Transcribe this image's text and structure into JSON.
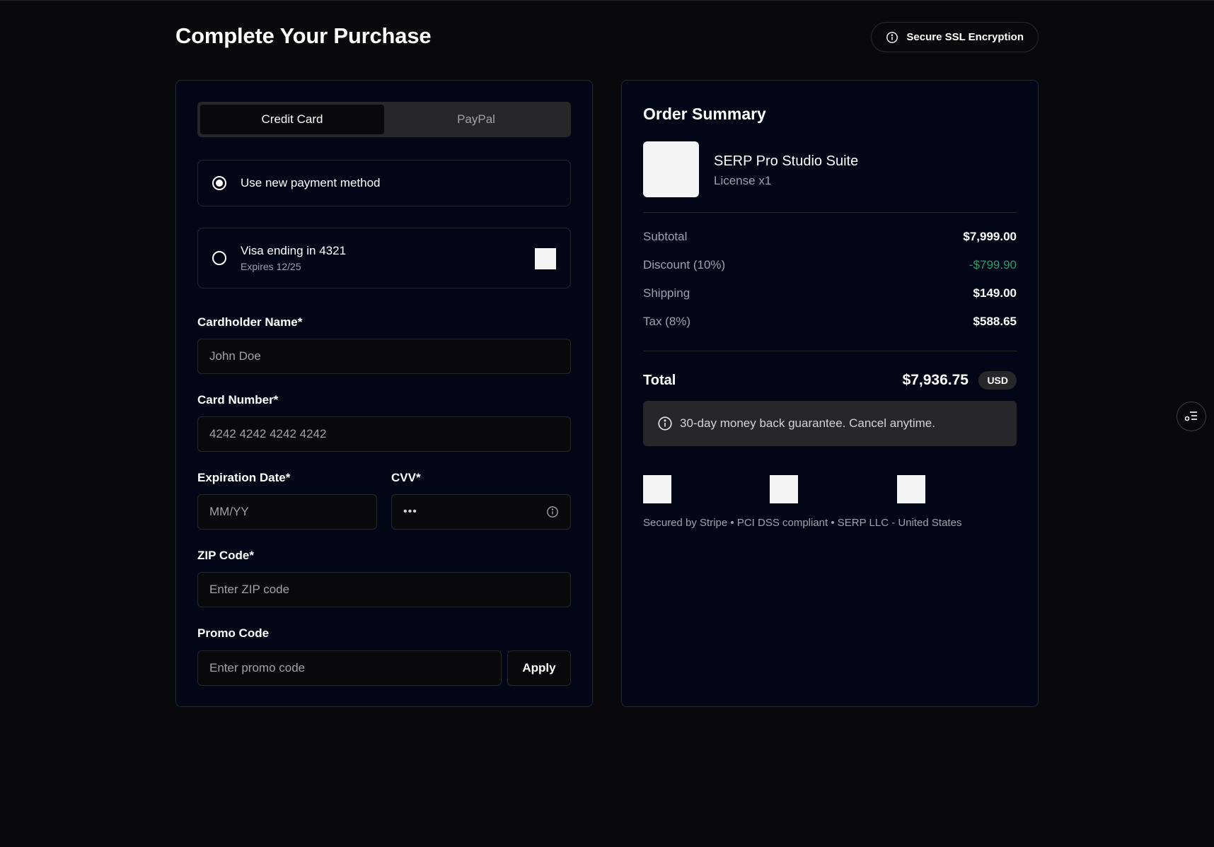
{
  "header": {
    "title": "Complete Your Purchase",
    "badge": "Secure SSL Encryption"
  },
  "payment": {
    "tabs": [
      {
        "label": "Credit Card",
        "active": true
      },
      {
        "label": "PayPal",
        "active": false
      }
    ],
    "methods": {
      "new": {
        "label": "Use new payment method",
        "selected": true
      },
      "saved": {
        "label": "Visa ending in 4321",
        "sub": "Expires 12/25",
        "selected": false
      }
    },
    "fields": {
      "cardholder": {
        "label": "Cardholder Name*",
        "placeholder": "John Doe"
      },
      "card_number": {
        "label": "Card Number*",
        "placeholder": "4242 4242 4242 4242"
      },
      "expiration": {
        "label": "Expiration Date*",
        "placeholder": "MM/YY"
      },
      "cvv": {
        "label": "CVV*",
        "value": "•••"
      },
      "zip": {
        "label": "ZIP Code*",
        "placeholder": "Enter ZIP code"
      },
      "promo": {
        "label": "Promo Code",
        "placeholder": "Enter promo code",
        "button": "Apply"
      }
    }
  },
  "summary": {
    "title": "Order Summary",
    "product": {
      "name": "SERP Pro Studio Suite",
      "sub": "License x1"
    },
    "lines": [
      {
        "label": "Subtotal",
        "value": "$7,999.00"
      },
      {
        "label": "Discount (10%)",
        "value": "-$799.90"
      },
      {
        "label": "Shipping",
        "value": "$149.00"
      },
      {
        "label": "Tax (8%)",
        "value": "$588.65"
      }
    ],
    "total": {
      "label": "Total",
      "value": "$7,936.75",
      "currency": "USD"
    },
    "guarantee": "30-day money back guarantee. Cancel anytime.",
    "footer": "Secured by Stripe • PCI DSS compliant • SERP LLC - United States"
  },
  "colors": {
    "background": "#09090b",
    "card": "#020617",
    "discount": "#22a06b"
  }
}
